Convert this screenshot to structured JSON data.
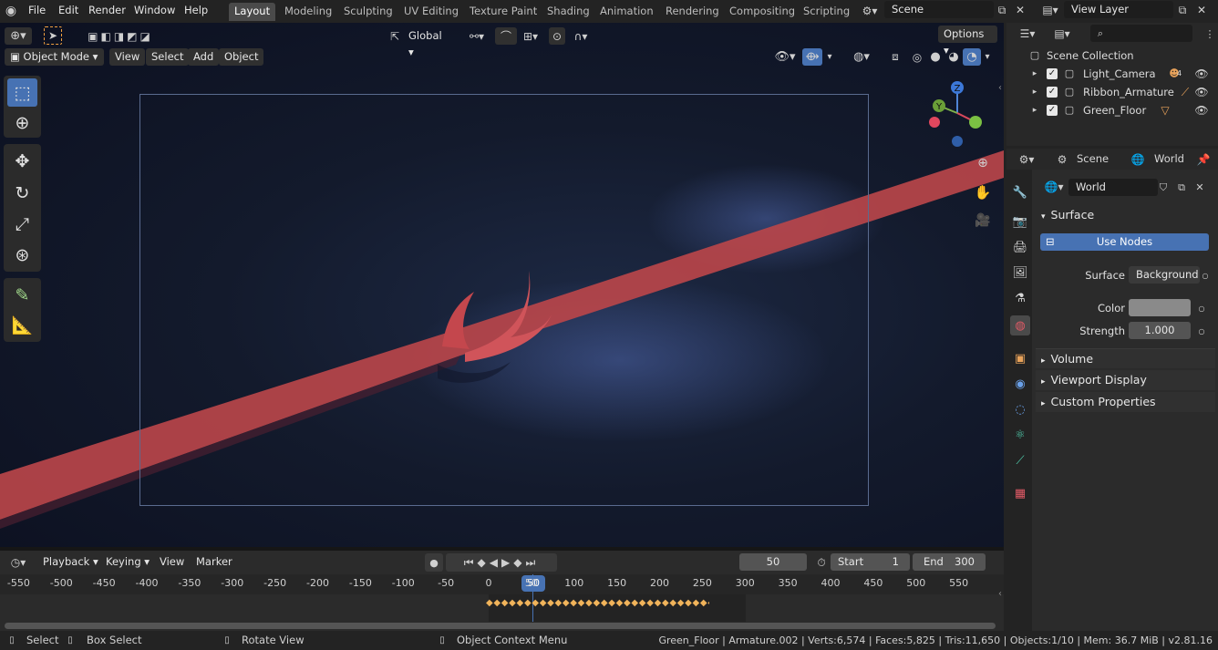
{
  "topbar": {
    "menus": [
      "File",
      "Edit",
      "Render",
      "Window",
      "Help"
    ],
    "workspaces": [
      "Layout",
      "Modeling",
      "Sculpting",
      "UV Editing",
      "Texture Paint",
      "Shading",
      "Animation",
      "Rendering",
      "Compositing",
      "Scripting"
    ],
    "active_workspace": "Layout",
    "scene_name": "Scene",
    "view_layer": "View Layer"
  },
  "tool_header": {
    "orientation": "Global",
    "options_label": "Options"
  },
  "viewport_header": {
    "mode": "Object Mode",
    "menus": [
      "View",
      "Select",
      "Add",
      "Object"
    ]
  },
  "gizmo": {
    "z": "Z",
    "y": "Y",
    "x": "X"
  },
  "timeline": {
    "editor_menus": [
      "Playback",
      "Keying",
      "View",
      "Marker"
    ],
    "current_frame": "50",
    "start_label": "Start",
    "start_value": "1",
    "end_label": "End",
    "end_value": "300",
    "ticks": [
      "-550",
      "-500",
      "-450",
      "-400",
      "-350",
      "-300",
      "-250",
      "-200",
      "-150",
      "-100",
      "-50",
      "0",
      "50",
      "100",
      "150",
      "200",
      "250",
      "300",
      "350",
      "400",
      "450",
      "500",
      "550"
    ],
    "playhead_label": "50"
  },
  "outliner": {
    "search_placeholder": "",
    "root": "Scene Collection",
    "items": [
      {
        "name": "Light_Camera"
      },
      {
        "name": "Ribbon_Armature"
      },
      {
        "name": "Green_Floor"
      }
    ],
    "badge_count": "4"
  },
  "properties": {
    "breadcrumb_scene": "Scene",
    "breadcrumb_world": "World",
    "world_name": "World",
    "surface_panel": "Surface",
    "use_nodes": "Use Nodes",
    "surface_label": "Surface",
    "surface_value": "Background",
    "color_label": "Color",
    "color_value": "#8a8a8a",
    "strength_label": "Strength",
    "strength_value": "1.000",
    "collapsed_panels": [
      "Volume",
      "Viewport Display",
      "Custom Properties"
    ]
  },
  "statusbar": {
    "select": "Select",
    "box_select": "Box Select",
    "rotate_view": "Rotate View",
    "context_menu": "Object Context Menu",
    "stats": "Green_Floor | Armature.002 | Verts:6,574 | Faces:5,825 | Tris:11,650 | Objects:1/10 | Mem: 36.7 MiB | v2.81.16"
  },
  "colors": {
    "accent": "#4772b3",
    "ribbon": "#c0474a",
    "keyframe": "#f0b35a"
  }
}
